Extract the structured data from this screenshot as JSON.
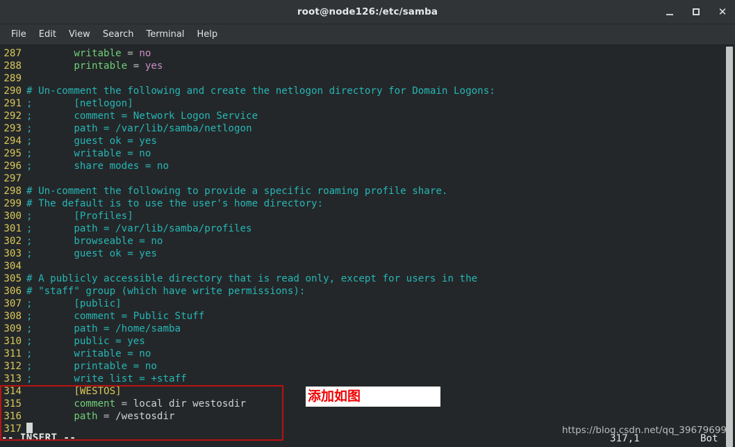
{
  "window": {
    "title": "root@node126:/etc/samba",
    "controls": [
      {
        "name": "minimize",
        "glyph": "_"
      },
      {
        "name": "maximize",
        "glyph": "□"
      },
      {
        "name": "close",
        "glyph": "✕"
      }
    ]
  },
  "menubar": {
    "items": [
      "File",
      "Edit",
      "View",
      "Search",
      "Terminal",
      "Help"
    ]
  },
  "editor": {
    "mode_label": "-- INSERT --",
    "position": "317,1",
    "scroll_label": "Bot",
    "lines": [
      {
        "num": "287",
        "segments": [
          {
            "text": "        writable ",
            "cls": "c-key"
          },
          {
            "text": "= ",
            "cls": "c-op"
          },
          {
            "text": "no",
            "cls": "c-valpink"
          }
        ]
      },
      {
        "num": "288",
        "segments": [
          {
            "text": "        printable ",
            "cls": "c-key"
          },
          {
            "text": "= ",
            "cls": "c-op"
          },
          {
            "text": "yes",
            "cls": "c-valpink"
          }
        ]
      },
      {
        "num": "289",
        "segments": []
      },
      {
        "num": "290",
        "segments": [
          {
            "text": "# Un-comment the following and create the netlogon directory for Domain Logons:",
            "cls": "c-comment"
          }
        ]
      },
      {
        "num": "291",
        "segments": [
          {
            "text": ";       [netlogon]",
            "cls": "c-comment"
          }
        ]
      },
      {
        "num": "292",
        "segments": [
          {
            "text": ";       comment = Network Logon Service",
            "cls": "c-comment"
          }
        ]
      },
      {
        "num": "293",
        "segments": [
          {
            "text": ";       path = /var/lib/samba/netlogon",
            "cls": "c-comment"
          }
        ]
      },
      {
        "num": "294",
        "segments": [
          {
            "text": ";       guest ok = yes",
            "cls": "c-comment"
          }
        ]
      },
      {
        "num": "295",
        "segments": [
          {
            "text": ";       writable = no",
            "cls": "c-comment"
          }
        ]
      },
      {
        "num": "296",
        "segments": [
          {
            "text": ";       share modes = no",
            "cls": "c-comment"
          }
        ]
      },
      {
        "num": "297",
        "segments": []
      },
      {
        "num": "298",
        "segments": [
          {
            "text": "# Un-comment the following to provide a specific roaming profile share.",
            "cls": "c-comment"
          }
        ]
      },
      {
        "num": "299",
        "segments": [
          {
            "text": "# The default is to use the user's home directory:",
            "cls": "c-comment"
          }
        ]
      },
      {
        "num": "300",
        "segments": [
          {
            "text": ";       [Profiles]",
            "cls": "c-comment"
          }
        ]
      },
      {
        "num": "301",
        "segments": [
          {
            "text": ";       path = /var/lib/samba/profiles",
            "cls": "c-comment"
          }
        ]
      },
      {
        "num": "302",
        "segments": [
          {
            "text": ";       browseable = no",
            "cls": "c-comment"
          }
        ]
      },
      {
        "num": "303",
        "segments": [
          {
            "text": ";       guest ok = yes",
            "cls": "c-comment"
          }
        ]
      },
      {
        "num": "304",
        "segments": []
      },
      {
        "num": "305",
        "segments": [
          {
            "text": "# A publicly accessible directory that is read only, except for users in the",
            "cls": "c-comment"
          }
        ]
      },
      {
        "num": "306",
        "segments": [
          {
            "text": "# \"staff\" group (which have write permissions):",
            "cls": "c-comment"
          }
        ]
      },
      {
        "num": "307",
        "segments": [
          {
            "text": ";       [public]",
            "cls": "c-comment"
          }
        ]
      },
      {
        "num": "308",
        "segments": [
          {
            "text": ";       comment = Public Stuff",
            "cls": "c-comment"
          }
        ]
      },
      {
        "num": "309",
        "segments": [
          {
            "text": ";       path = /home/samba",
            "cls": "c-comment"
          }
        ]
      },
      {
        "num": "310",
        "segments": [
          {
            "text": ";       public = yes",
            "cls": "c-comment"
          }
        ]
      },
      {
        "num": "311",
        "segments": [
          {
            "text": ";       writable = no",
            "cls": "c-comment"
          }
        ]
      },
      {
        "num": "312",
        "segments": [
          {
            "text": ";       printable = no",
            "cls": "c-comment"
          }
        ]
      },
      {
        "num": "313",
        "segments": [
          {
            "text": ";       write list = +staff",
            "cls": "c-comment"
          }
        ]
      },
      {
        "num": "314",
        "segments": [
          {
            "text": "        [WESTOS]",
            "cls": "c-section"
          }
        ]
      },
      {
        "num": "315",
        "segments": [
          {
            "text": "        comment ",
            "cls": "c-key"
          },
          {
            "text": "= ",
            "cls": "c-op"
          },
          {
            "text": "local dir westosdir",
            "cls": "c-plain"
          }
        ]
      },
      {
        "num": "316",
        "segments": [
          {
            "text": "        path ",
            "cls": "c-key"
          },
          {
            "text": "= ",
            "cls": "c-op"
          },
          {
            "text": "/westosdir",
            "cls": "c-plain"
          }
        ]
      },
      {
        "num": "317",
        "segments": [],
        "cursor": true
      }
    ]
  },
  "annotations": {
    "note_text": "添加如图",
    "watermark": "https://blog.csdn.net/qq_39679699",
    "highlight_color": "#bb1111"
  }
}
